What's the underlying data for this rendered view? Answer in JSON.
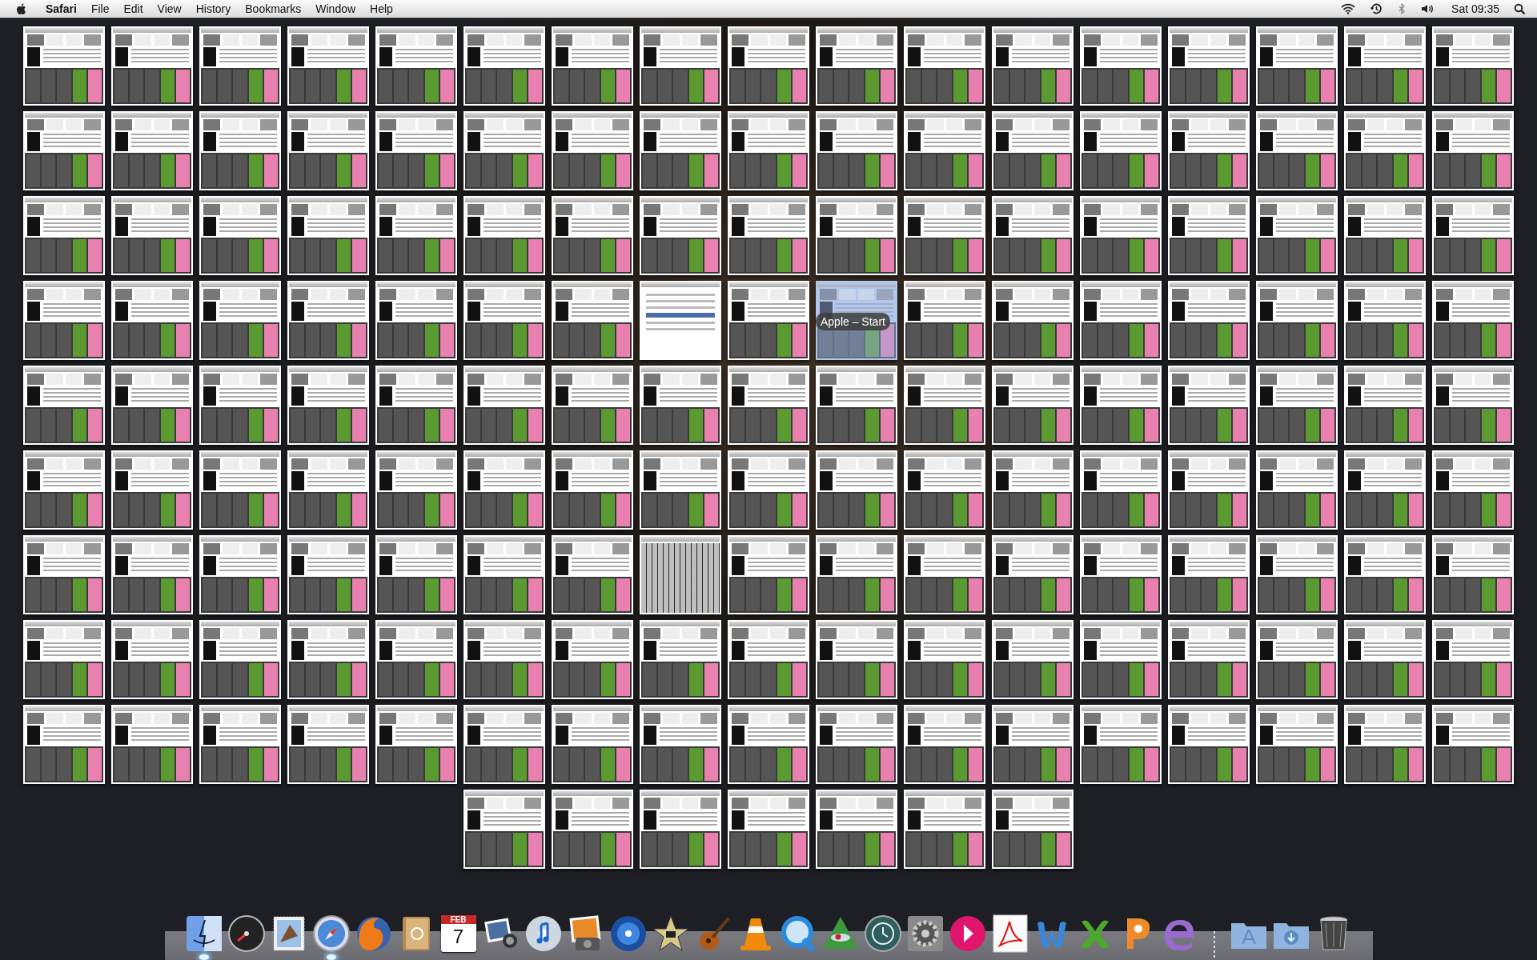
{
  "menu_bar": {
    "app_name": "Safari",
    "menus": [
      "File",
      "Edit",
      "View",
      "History",
      "Bookmarks",
      "Window",
      "Help"
    ],
    "clock": "Sat 09:35"
  },
  "tooltip": "Apple – Start",
  "windows": [
    {
      "kind": "apple-page",
      "selected": false
    },
    {
      "kind": "apple-page",
      "selected": false
    },
    {
      "kind": "apple-page",
      "selected": false
    },
    {
      "kind": "apple-page",
      "selected": false
    },
    {
      "kind": "apple-page",
      "selected": false
    },
    {
      "kind": "apple-page",
      "selected": false
    },
    {
      "kind": "apple-page",
      "selected": false
    },
    {
      "kind": "apple-page",
      "selected": false
    },
    {
      "kind": "apple-page",
      "selected": false
    },
    {
      "kind": "apple-page",
      "selected": false
    },
    {
      "kind": "apple-page",
      "selected": false
    },
    {
      "kind": "apple-page",
      "selected": false
    },
    {
      "kind": "apple-page",
      "selected": false
    },
    {
      "kind": "apple-page",
      "selected": false
    },
    {
      "kind": "apple-page",
      "selected": false
    },
    {
      "kind": "apple-page",
      "selected": false
    },
    {
      "kind": "apple-page",
      "selected": false
    },
    {
      "kind": "apple-page",
      "selected": false
    },
    {
      "kind": "apple-page",
      "selected": false
    },
    {
      "kind": "apple-page",
      "selected": false
    },
    {
      "kind": "apple-page",
      "selected": false
    },
    {
      "kind": "apple-page",
      "selected": false
    },
    {
      "kind": "apple-page",
      "selected": false
    },
    {
      "kind": "apple-page",
      "selected": false
    },
    {
      "kind": "apple-page",
      "selected": false
    },
    {
      "kind": "apple-page",
      "selected": false
    },
    {
      "kind": "apple-page",
      "selected": false
    },
    {
      "kind": "apple-page",
      "selected": false
    },
    {
      "kind": "apple-page",
      "selected": false
    },
    {
      "kind": "apple-page",
      "selected": false
    },
    {
      "kind": "apple-page",
      "selected": false
    },
    {
      "kind": "apple-page",
      "selected": false
    },
    {
      "kind": "apple-page",
      "selected": false
    },
    {
      "kind": "apple-page",
      "selected": false
    },
    {
      "kind": "apple-page",
      "selected": false
    },
    {
      "kind": "apple-page",
      "selected": false
    },
    {
      "kind": "apple-page",
      "selected": false
    },
    {
      "kind": "apple-page",
      "selected": false
    },
    {
      "kind": "apple-page",
      "selected": false
    },
    {
      "kind": "apple-page",
      "selected": false
    },
    {
      "kind": "apple-page",
      "selected": false
    },
    {
      "kind": "apple-page",
      "selected": false
    },
    {
      "kind": "apple-page",
      "selected": false
    },
    {
      "kind": "apple-page",
      "selected": false
    },
    {
      "kind": "apple-page",
      "selected": false
    },
    {
      "kind": "apple-page",
      "selected": false
    },
    {
      "kind": "apple-page",
      "selected": false
    },
    {
      "kind": "apple-page",
      "selected": false
    },
    {
      "kind": "apple-page",
      "selected": false
    },
    {
      "kind": "apple-page",
      "selected": false
    },
    {
      "kind": "apple-page",
      "selected": false
    },
    {
      "kind": "apple-page",
      "selected": false
    },
    {
      "kind": "apple-page",
      "selected": false
    },
    {
      "kind": "apple-page",
      "selected": false
    },
    {
      "kind": "apple-page",
      "selected": false
    },
    {
      "kind": "apple-page",
      "selected": false
    },
    {
      "kind": "apple-page",
      "selected": false
    },
    {
      "kind": "apple-page",
      "selected": false
    },
    {
      "kind": "other-page",
      "selected": false
    },
    {
      "kind": "apple-page",
      "selected": false
    },
    {
      "kind": "apple-page",
      "selected": true
    },
    {
      "kind": "apple-page",
      "selected": false
    },
    {
      "kind": "apple-page",
      "selected": false
    },
    {
      "kind": "apple-page",
      "selected": false
    },
    {
      "kind": "apple-page",
      "selected": false
    },
    {
      "kind": "apple-page",
      "selected": false
    },
    {
      "kind": "apple-page",
      "selected": false
    },
    {
      "kind": "apple-page",
      "selected": false
    },
    {
      "kind": "apple-page",
      "selected": false
    },
    {
      "kind": "apple-page",
      "selected": false
    },
    {
      "kind": "apple-page",
      "selected": false
    },
    {
      "kind": "apple-page",
      "selected": false
    },
    {
      "kind": "apple-page",
      "selected": false
    },
    {
      "kind": "apple-page",
      "selected": false
    },
    {
      "kind": "apple-page",
      "selected": false
    },
    {
      "kind": "apple-page",
      "selected": false
    },
    {
      "kind": "apple-page",
      "selected": false
    },
    {
      "kind": "apple-page",
      "selected": false
    },
    {
      "kind": "apple-page",
      "selected": false
    },
    {
      "kind": "apple-page",
      "selected": false
    },
    {
      "kind": "apple-page",
      "selected": false
    },
    {
      "kind": "apple-page",
      "selected": false
    },
    {
      "kind": "apple-page",
      "selected": false
    },
    {
      "kind": "apple-page",
      "selected": false
    },
    {
      "kind": "apple-page",
      "selected": false
    },
    {
      "kind": "apple-page",
      "selected": false
    },
    {
      "kind": "apple-page",
      "selected": false
    },
    {
      "kind": "apple-page",
      "selected": false
    },
    {
      "kind": "apple-page",
      "selected": false
    },
    {
      "kind": "apple-page",
      "selected": false
    },
    {
      "kind": "apple-page",
      "selected": false
    },
    {
      "kind": "apple-page",
      "selected": false
    },
    {
      "kind": "apple-page",
      "selected": false
    },
    {
      "kind": "apple-page",
      "selected": false
    },
    {
      "kind": "apple-page",
      "selected": false
    },
    {
      "kind": "apple-page",
      "selected": false
    },
    {
      "kind": "apple-page",
      "selected": false
    },
    {
      "kind": "apple-page",
      "selected": false
    },
    {
      "kind": "apple-page",
      "selected": false
    },
    {
      "kind": "apple-page",
      "selected": false
    },
    {
      "kind": "apple-page",
      "selected": false
    },
    {
      "kind": "apple-page",
      "selected": false
    },
    {
      "kind": "apple-page",
      "selected": false
    },
    {
      "kind": "apple-page",
      "selected": false
    },
    {
      "kind": "apple-page",
      "selected": false
    },
    {
      "kind": "apple-page",
      "selected": false
    },
    {
      "kind": "apple-page",
      "selected": false
    },
    {
      "kind": "apple-page",
      "selected": false
    },
    {
      "kind": "apple-page",
      "selected": false
    },
    {
      "kind": "expose-collage",
      "selected": false
    },
    {
      "kind": "apple-page",
      "selected": false
    },
    {
      "kind": "apple-page",
      "selected": false
    },
    {
      "kind": "apple-page",
      "selected": false
    },
    {
      "kind": "apple-page",
      "selected": false
    },
    {
      "kind": "apple-page",
      "selected": false
    },
    {
      "kind": "apple-page",
      "selected": false
    },
    {
      "kind": "apple-page",
      "selected": false
    },
    {
      "kind": "apple-page",
      "selected": false
    },
    {
      "kind": "apple-page",
      "selected": false
    },
    {
      "kind": "apple-page",
      "selected": false
    },
    {
      "kind": "apple-page",
      "selected": false
    },
    {
      "kind": "apple-page",
      "selected": false
    },
    {
      "kind": "apple-page",
      "selected": false
    },
    {
      "kind": "apple-page",
      "selected": false
    },
    {
      "kind": "apple-page",
      "selected": false
    },
    {
      "kind": "apple-page",
      "selected": false
    },
    {
      "kind": "apple-page",
      "selected": false
    },
    {
      "kind": "apple-page",
      "selected": false
    },
    {
      "kind": "apple-page",
      "selected": false
    },
    {
      "kind": "apple-page",
      "selected": false
    },
    {
      "kind": "apple-page",
      "selected": false
    },
    {
      "kind": "apple-page",
      "selected": false
    },
    {
      "kind": "apple-page",
      "selected": false
    },
    {
      "kind": "apple-page",
      "selected": false
    },
    {
      "kind": "apple-page",
      "selected": false
    },
    {
      "kind": "apple-page",
      "selected": false
    },
    {
      "kind": "apple-page",
      "selected": false
    },
    {
      "kind": "apple-page",
      "selected": false
    },
    {
      "kind": "apple-page",
      "selected": false
    },
    {
      "kind": "apple-page",
      "selected": false
    },
    {
      "kind": "apple-page",
      "selected": false
    },
    {
      "kind": "apple-page",
      "selected": false
    },
    {
      "kind": "apple-page",
      "selected": false
    },
    {
      "kind": "apple-page",
      "selected": false
    },
    {
      "kind": "apple-page",
      "selected": false
    },
    {
      "kind": "apple-page",
      "selected": false
    },
    {
      "kind": "apple-page",
      "selected": false
    },
    {
      "kind": "apple-page",
      "selected": false
    },
    {
      "kind": "apple-page",
      "selected": false
    },
    {
      "kind": "apple-page",
      "selected": false
    },
    {
      "kind": "apple-page",
      "selected": false
    },
    {
      "kind": "apple-page",
      "selected": false
    },
    {
      "kind": "apple-page",
      "selected": false
    },
    {
      "kind": "apple-page",
      "selected": false
    },
    {
      "kind": "apple-page",
      "selected": false
    },
    {
      "kind": "apple-page",
      "selected": false
    },
    {
      "kind": "apple-page",
      "selected": false
    },
    {
      "kind": "apple-page",
      "selected": false
    },
    {
      "kind": "apple-page",
      "selected": false
    },
    {
      "kind": "apple-page",
      "selected": false
    }
  ],
  "dock": [
    {
      "kind": "finder",
      "running": true
    },
    {
      "kind": "dashboard",
      "running": false
    },
    {
      "kind": "mail",
      "running": false
    },
    {
      "kind": "safari",
      "running": true
    },
    {
      "kind": "firefox",
      "running": false
    },
    {
      "kind": "address-book",
      "running": false
    },
    {
      "kind": "calendar",
      "running": false,
      "month": "FEB",
      "day": "7"
    },
    {
      "kind": "photo-booth",
      "running": false
    },
    {
      "kind": "itunes",
      "running": false
    },
    {
      "kind": "iphoto",
      "running": false
    },
    {
      "kind": "dvd",
      "running": false
    },
    {
      "kind": "imovie",
      "running": false
    },
    {
      "kind": "garageband",
      "running": false
    },
    {
      "kind": "vlc",
      "running": false
    },
    {
      "kind": "quicktime",
      "running": false
    },
    {
      "kind": "eye",
      "running": false
    },
    {
      "kind": "time-machine",
      "running": false
    },
    {
      "kind": "preferences",
      "running": false
    },
    {
      "kind": "pink-play",
      "running": false
    },
    {
      "kind": "acrobat",
      "running": false
    },
    {
      "kind": "word",
      "running": false
    },
    {
      "kind": "excel",
      "running": false
    },
    {
      "kind": "powerpoint",
      "running": false
    },
    {
      "kind": "entourage",
      "running": false
    },
    {
      "kind": "separator"
    },
    {
      "kind": "apps-folder",
      "running": false
    },
    {
      "kind": "downloads-folder",
      "running": false
    },
    {
      "kind": "trash",
      "running": false
    }
  ]
}
